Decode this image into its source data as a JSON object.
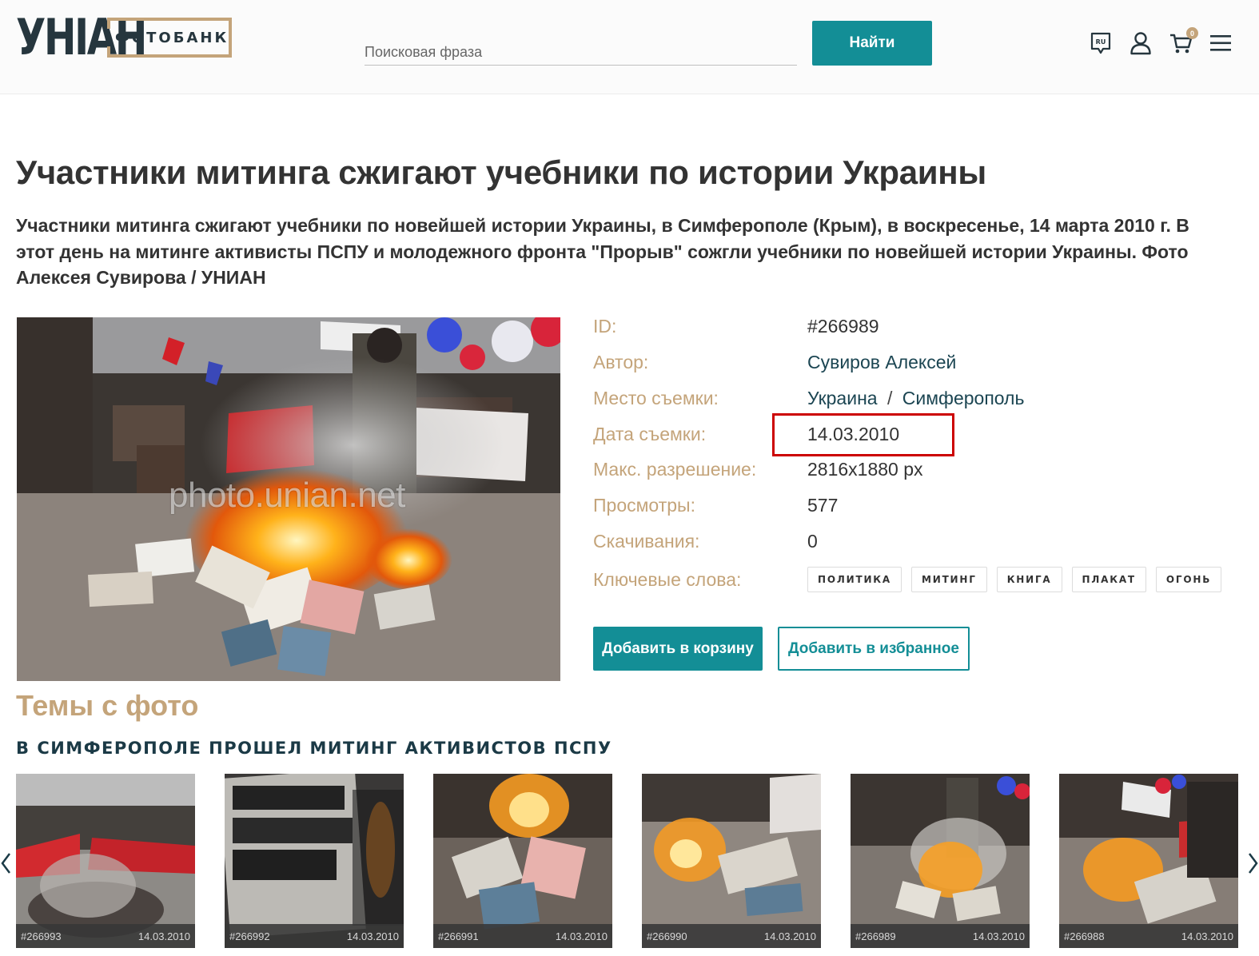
{
  "header": {
    "logo_text": "УНІАН",
    "logo_sub": "ФОТОБАНК",
    "search_placeholder": "Поисковая фраза",
    "search_button": "Найти",
    "lang_badge": "RU",
    "cart_count": "0",
    "icons": [
      "language-icon",
      "user-icon",
      "cart-icon",
      "menu-icon"
    ]
  },
  "title": "Участники митинга сжигают учебники по истории Украины",
  "description": "Участники митинга сжигают учебники по новейшей истории Украины, в Симферополе (Крым), в воскресенье, 14 марта 2010 г. В этот день на митинге активисты ПСПУ и молодежного фронта \"Прорыв\" сожгли учебники по новейшей истории Украины. Фото Алексея Сувирова / УНИАН",
  "photo": {
    "watermark": "photo.unian.net"
  },
  "info": {
    "id_label": "ID:",
    "id_value": "#266989",
    "author_label": "Автор:",
    "author_value": "Сувиров Алексей",
    "place_label": "Место съемки:",
    "place_country": "Украина",
    "place_sep": "/",
    "place_city": "Симферополь",
    "date_label": "Дата съемки:",
    "date_value": "14.03.2010",
    "res_label": "Макс. разрешение:",
    "res_value": "2816x1880 px",
    "views_label": "Просмотры:",
    "views_value": "577",
    "downloads_label": "Скачивания:",
    "downloads_value": "0",
    "keywords_label": "Ключевые слова:",
    "keywords": [
      "ПОЛИТИКА",
      "МИТИНГ",
      "КНИГА",
      "ПЛАКАТ",
      "ОГОНЬ"
    ]
  },
  "actions": {
    "add_to_cart": "Добавить в корзину",
    "add_to_favorites": "Добавить в избранное"
  },
  "themes": {
    "title": "Темы с фото",
    "heading": "В Симферополе прошел митинг активистов ПСПУ",
    "thumbs": [
      {
        "id": "#266993",
        "date": "14.03.2010"
      },
      {
        "id": "#266992",
        "date": "14.03.2010"
      },
      {
        "id": "#266991",
        "date": "14.03.2010"
      },
      {
        "id": "#266990",
        "date": "14.03.2010"
      },
      {
        "id": "#266989",
        "date": "14.03.2010"
      },
      {
        "id": "#266988",
        "date": "14.03.2010"
      }
    ]
  },
  "colors": {
    "accent_teal": "#138e96",
    "gold": "#c4a47a",
    "dark_navy": "#1b3a46",
    "highlight_red": "#cc0000"
  }
}
